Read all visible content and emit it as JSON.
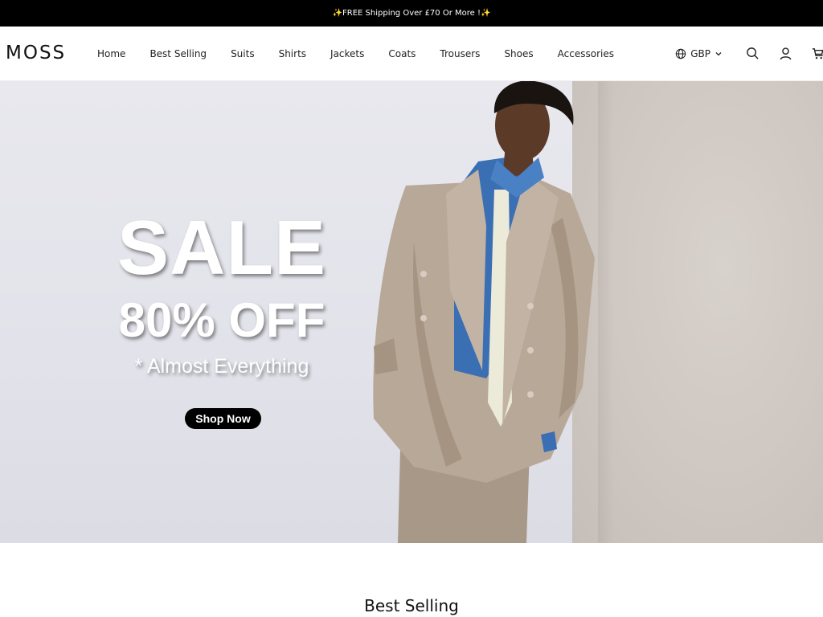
{
  "announcement": "✨FREE Shipping Over £70 Or More !✨",
  "header": {
    "logo": "MOSS",
    "nav": [
      "Home",
      "Best Selling",
      "Suits",
      "Shirts",
      "Jackets",
      "Coats",
      "Trousers",
      "Shoes",
      "Accessories"
    ],
    "currency": "GBP",
    "icons": [
      "globe-icon",
      "chevron-down-icon",
      "search-icon",
      "account-icon",
      "cart-icon"
    ]
  },
  "hero": {
    "headline": "SALE",
    "discount": "80% OFF",
    "subline": "* Almost Everything",
    "cta": "Shop Now"
  },
  "sections": {
    "best_selling_title": "Best Selling"
  },
  "colors": {
    "announcement_bg": "#000000",
    "cta_bg": "#000000",
    "hero_bg": "#e4e4ec",
    "suit": "#b8a898",
    "shirt": "#3a6fb4"
  }
}
